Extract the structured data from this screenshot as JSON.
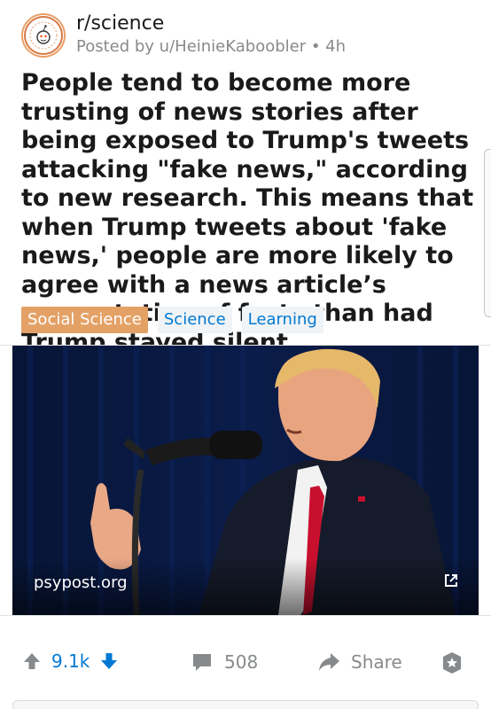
{
  "post": {
    "subreddit": "r/science",
    "posted_by": "Posted by u/HeinieKaboobler • 4h",
    "title": "People tend to become more trusting of news stories after being exposed to Trump's tweets attacking \"fake news,\" according to new research. This means that when Trump tweets about 'fake news,' people are more likely to agree with a news article’s presentation of facts than had Trump stayed silent",
    "flairs": [
      "Social Science",
      "Science",
      "Learning"
    ],
    "link_domain": "psypost.org"
  },
  "actions": {
    "score": "9.1k",
    "comments": "508",
    "share_label": "Share"
  },
  "colors": {
    "accent": "#0079d3",
    "flair_primary": "#e4a166",
    "muted": "#878a8c"
  },
  "icons": [
    "subreddit-avatar-icon",
    "external-link-icon",
    "upvote-icon",
    "downvote-icon",
    "comment-icon",
    "share-icon",
    "award-icon"
  ]
}
